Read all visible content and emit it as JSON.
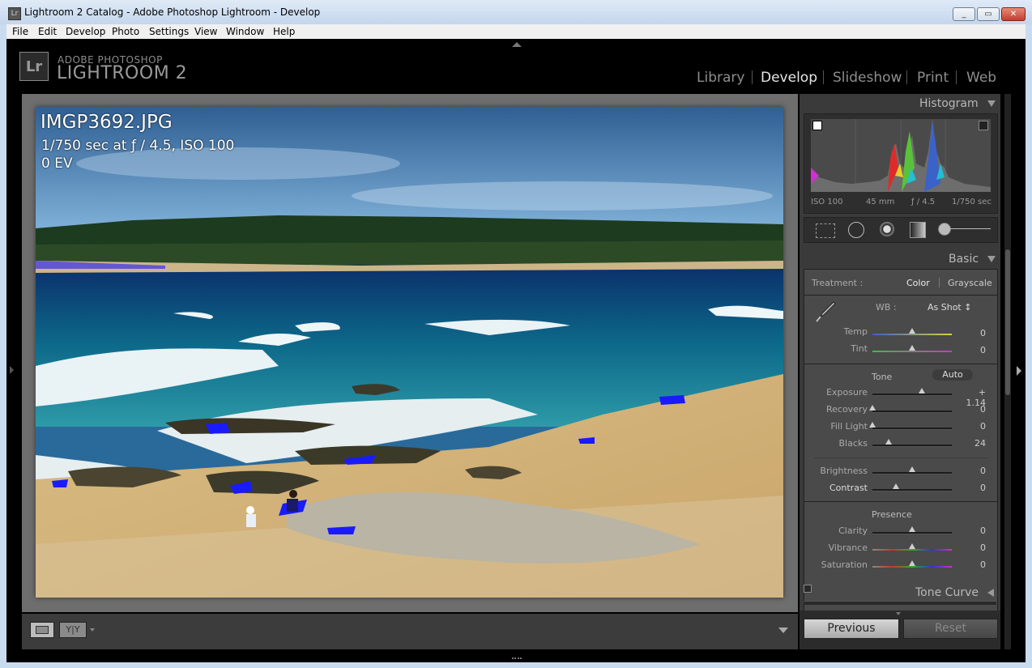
{
  "window": {
    "title": "Lightroom 2 Catalog - Adobe Photoshop Lightroom - Develop",
    "app_icon": "Lr",
    "controls": [
      "minimize",
      "maximize",
      "close"
    ]
  },
  "menu": [
    "File",
    "Edit",
    "Develop",
    "Photo",
    "Settings",
    "View",
    "Window",
    "Help"
  ],
  "branding": {
    "badge": "Lr",
    "line1": "ADOBE PHOTOSHOP",
    "line2": "LIGHTROOM 2"
  },
  "modules": [
    {
      "label": "Library",
      "active": false
    },
    {
      "label": "Develop",
      "active": true
    },
    {
      "label": "Slideshow",
      "active": false
    },
    {
      "label": "Print",
      "active": false
    },
    {
      "label": "Web",
      "active": false
    }
  ],
  "photo": {
    "filename": "IMGP3692.JPG",
    "exposure_info": "1/750 sec at ƒ / 4.5, ISO 100",
    "ev": "0 EV"
  },
  "toolbar": {
    "view_icon": "loupe-view-icon",
    "compare_label": "Y|Y"
  },
  "histogram": {
    "title": "Histogram",
    "iso": "ISO 100",
    "focal": "45 mm",
    "aperture": "ƒ / 4.5",
    "shutter": "1/750 sec"
  },
  "basic": {
    "title": "Basic",
    "treatment_label": "Treatment :",
    "color_label": "Color",
    "grayscale_label": "Grayscale",
    "wb_label": "WB :",
    "wb_value": "As Shot ↕",
    "tone_label": "Tone",
    "auto_label": "Auto",
    "presence_label": "Presence",
    "sliders": {
      "temp": {
        "label": "Temp",
        "value": "0",
        "position": 0.5
      },
      "tint": {
        "label": "Tint",
        "value": "0",
        "position": 0.5
      },
      "exposure": {
        "label": "Exposure",
        "value": "+ 1.14",
        "position": 0.62
      },
      "recovery": {
        "label": "Recovery",
        "value": "0",
        "position": 0.0
      },
      "fill_light": {
        "label": "Fill Light",
        "value": "0",
        "position": 0.0
      },
      "blacks": {
        "label": "Blacks",
        "value": "24",
        "position": 0.2
      },
      "brightness": {
        "label": "Brightness",
        "value": "0",
        "position": 0.5
      },
      "contrast": {
        "label": "Contrast",
        "value": "0",
        "position": 0.3
      },
      "clarity": {
        "label": "Clarity",
        "value": "0",
        "position": 0.5
      },
      "vibrance": {
        "label": "Vibrance",
        "value": "0",
        "position": 0.5
      },
      "saturation": {
        "label": "Saturation",
        "value": "0",
        "position": 0.5
      }
    }
  },
  "tone_curve": {
    "title": "Tone Curve"
  },
  "buttons": {
    "previous": "Previous",
    "reset": "Reset"
  },
  "colors": {
    "panel_bg": "#3a3a3a",
    "active_module": "#e6e6e6",
    "inactive_module": "#8e8e8e",
    "clipping_overlay": "#1a1aff"
  }
}
